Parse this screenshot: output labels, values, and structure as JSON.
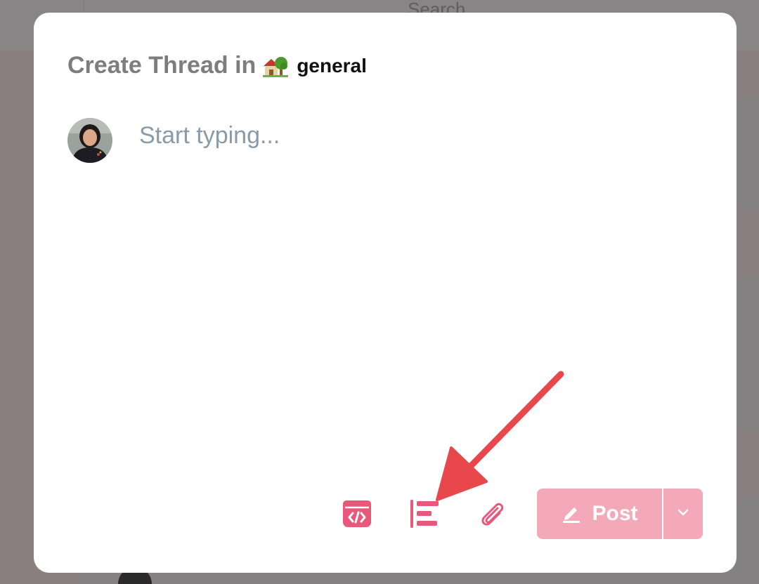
{
  "background": {
    "search_label": "Search"
  },
  "modal": {
    "title_prefix": "Create Thread in",
    "channel_emoji": "house-with-tree-emoji",
    "channel_name": "general",
    "composer_placeholder": "Start typing...",
    "composer_value": ""
  },
  "toolbar": {
    "code_icon": "code-block-icon",
    "format_icon": "text-format-icon",
    "attach_icon": "paperclip-icon",
    "post_label": "Post",
    "post_icon": "pencil-icon",
    "dropdown_icon": "chevron-down-icon"
  },
  "annotation": {
    "arrow_icon": "pointer-arrow",
    "color": "#e8474c"
  },
  "colors": {
    "accent": "#e9587a",
    "post_button": "#f4a9b9",
    "placeholder": "#8a9aa8",
    "title_gray": "#7d7d7d"
  }
}
